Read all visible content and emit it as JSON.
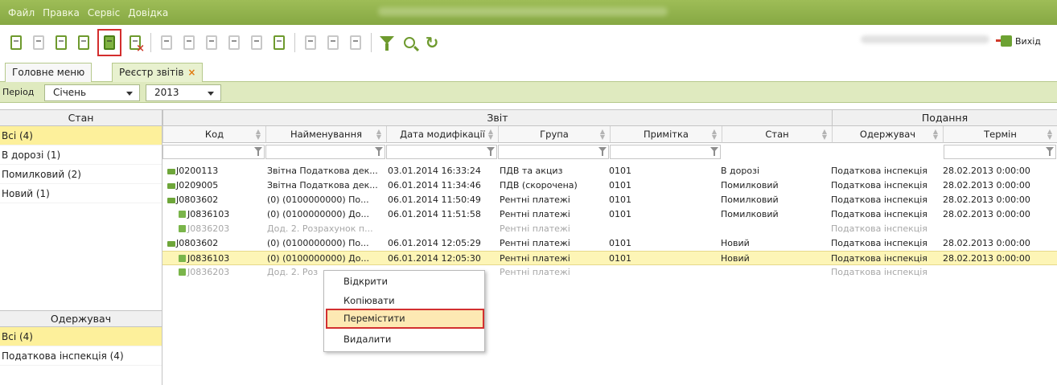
{
  "menu": {
    "items": [
      "Файл",
      "Правка",
      "Сервіс",
      "Довідка"
    ]
  },
  "toolbar": {
    "icons": [
      "new-doc-icon",
      "edit-doc-icon",
      "import-icon",
      "copy-doc-icon",
      "move-doc-icon",
      "delete-doc-icon",
      "save-icon",
      "print-icon",
      "sign-icon",
      "archive-icon",
      "send-icon",
      "receive-icon",
      "list-icon",
      "list-edit-icon",
      "list-check-icon",
      "filter-icon",
      "search-icon",
      "refresh-icon"
    ],
    "exit_label": "Вихід"
  },
  "tabs": [
    {
      "label": "Головне меню",
      "closable": false
    },
    {
      "label": "Реєстр звітів",
      "closable": true,
      "close_glyph": "×"
    }
  ],
  "filter": {
    "period_label": "Період",
    "month": "Січень",
    "year": "2013"
  },
  "left": {
    "stan_header": "Стан",
    "stan_items": [
      "Всі (4)",
      "В дорозі (1)",
      "Помилковий (2)",
      "Новий (1)"
    ],
    "recipient_header": "Одержувач",
    "recipient_items": [
      "Всі (4)",
      "Податкова інспекція (4)"
    ]
  },
  "grid": {
    "group_headers": {
      "report": "Звіт",
      "submission": "Подання"
    },
    "columns": [
      "Код",
      "Найменування",
      "Дата модифікації",
      "Група",
      "Примітка",
      "Стан",
      "Одержувач",
      "Термін"
    ],
    "rows": [
      {
        "code": "J0200113",
        "name": "Звітна Податкова дек...",
        "date": "03.01.2014 16:33:24",
        "group": "ПДВ та акциз",
        "note": "0101",
        "state": "В дорозі",
        "recipient": "Податкова інспекція",
        "term": "28.02.2013 0:00:00"
      },
      {
        "code": "J0209005",
        "name": "Звітна Податкова дек...",
        "date": "06.01.2014 11:34:46",
        "group": "ПДВ (скорочена)",
        "note": "0101",
        "state": "Помилковий",
        "recipient": "Податкова інспекція",
        "term": "28.02.2013 0:00:00"
      },
      {
        "code": "J0803602",
        "name": "(0) (0100000000) По...",
        "date": "06.01.2014 11:50:49",
        "group": "Рентні платежі",
        "note": "0101",
        "state": "Помилковий",
        "recipient": "Податкова інспекція",
        "term": "28.02.2013 0:00:00"
      },
      {
        "code": "J0836103",
        "name": "(0) (0100000000) До...",
        "date": "06.01.2014 11:51:58",
        "group": "Рентні платежі",
        "note": "0101",
        "state": "Помилковий",
        "recipient": "Податкова інспекція",
        "term": "28.02.2013 0:00:00"
      },
      {
        "code": "J0836203",
        "name": "Дод. 2. Розрахунок п...",
        "date": "",
        "group": "Рентні платежі",
        "note": "",
        "state": "",
        "recipient": "Податкова інспекція",
        "term": ""
      },
      {
        "code": "J0803602",
        "name": "(0) (0100000000) По...",
        "date": "06.01.2014 12:05:29",
        "group": "Рентні платежі",
        "note": "0101",
        "state": "Новий",
        "recipient": "Податкова інспекція",
        "term": "28.02.2013 0:00:00"
      },
      {
        "code": "J0836103",
        "name": "(0) (0100000000) До...",
        "date": "06.01.2014 12:05:30",
        "group": "Рентні платежі",
        "note": "0101",
        "state": "Новий",
        "recipient": "Податкова інспекція",
        "term": "28.02.2013 0:00:00"
      },
      {
        "code": "J0836203",
        "name": "Дод. 2. Роз",
        "date": "",
        "group": "Рентні платежі",
        "note": "",
        "state": "",
        "recipient": "Податкова інспекція",
        "term": ""
      }
    ]
  },
  "context_menu": {
    "items": [
      "Відкрити",
      "Копіювати",
      "Перемістити",
      "Видалити"
    ],
    "highlighted": "Перемістити"
  },
  "colors": {
    "brand_green": "#86a843",
    "selection_yellow": "#fdf09b",
    "highlight_red": "#d32d2d"
  }
}
